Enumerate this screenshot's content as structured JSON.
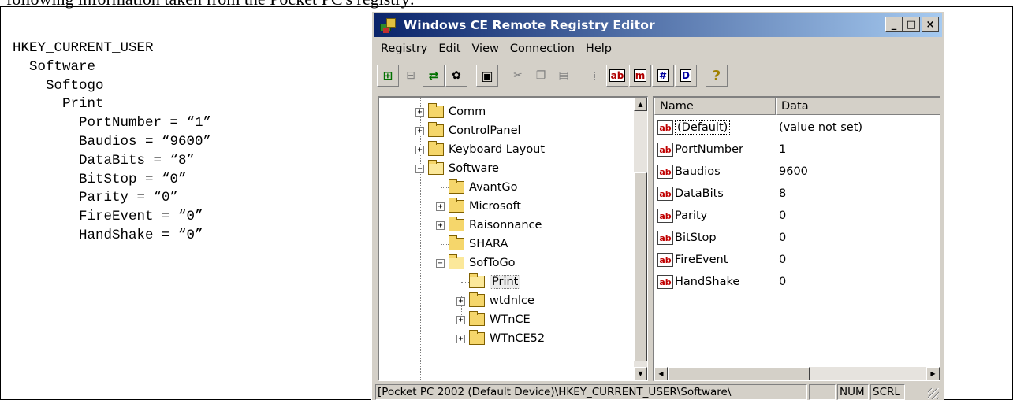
{
  "caption": "following information taken from the Pocket PC's registry:",
  "registry_text": [
    "HKEY_CURRENT_USER",
    "  Software",
    "    Softogo",
    "      Print",
    "        PortNumber = “1”",
    "        Baudios = “9600”",
    "        DataBits = “8”",
    "        BitStop = “0”",
    "        Parity = “0”",
    "        FireEvent = “0”",
    "        HandShake = “0”"
  ],
  "window": {
    "title": "Windows CE Remote Registry Editor",
    "controls": {
      "minimize": "_",
      "maximize": "□",
      "close": "×"
    }
  },
  "menu": [
    "Registry",
    "Edit",
    "View",
    "Connection",
    "Help"
  ],
  "toolbar_icons": [
    "connect-icon",
    "disconnect-icon",
    "refresh-icon",
    "network-icon",
    "save-icon",
    "cut-icon",
    "copy-icon",
    "paste-icon",
    "delete-icon",
    "string-value-icon",
    "multistring-value-icon",
    "binary-value-icon",
    "dword-value-icon",
    "help-icon"
  ],
  "tree": {
    "items": [
      {
        "label": "Comm",
        "expander": "+"
      },
      {
        "label": "ControlPanel",
        "expander": "+"
      },
      {
        "label": "Keyboard Layout",
        "expander": "+"
      },
      {
        "label": "Software",
        "expander": "−"
      },
      {
        "label": "AvantGo",
        "expander": ""
      },
      {
        "label": "Microsoft",
        "expander": "+"
      },
      {
        "label": "Raisonnance",
        "expander": "+"
      },
      {
        "label": "SHARA",
        "expander": ""
      },
      {
        "label": "SofToGo",
        "expander": "−"
      },
      {
        "label": "Print",
        "expander": "",
        "selected": true
      },
      {
        "label": "wtdnlce",
        "expander": "+"
      },
      {
        "label": "WTnCE",
        "expander": "+"
      },
      {
        "label": "WTnCE52",
        "expander": "+"
      }
    ]
  },
  "list": {
    "columns": [
      "Name",
      "Data"
    ],
    "rows": [
      {
        "name": "(Default)",
        "data": "(value not set)"
      },
      {
        "name": "PortNumber",
        "data": "1"
      },
      {
        "name": "Baudios",
        "data": "9600"
      },
      {
        "name": "DataBits",
        "data": "8"
      },
      {
        "name": "Parity",
        "data": "0"
      },
      {
        "name": "BitStop",
        "data": "0"
      },
      {
        "name": "FireEvent",
        "data": "0"
      },
      {
        "name": "HandShake",
        "data": "0"
      }
    ],
    "value_type_label": "ab"
  },
  "status": {
    "path": "[Pocket PC 2002 (Default Device)\\HKEY_CURRENT_USER\\Software\\",
    "empty": "",
    "num": "NUM",
    "scrl": "SCRL"
  }
}
